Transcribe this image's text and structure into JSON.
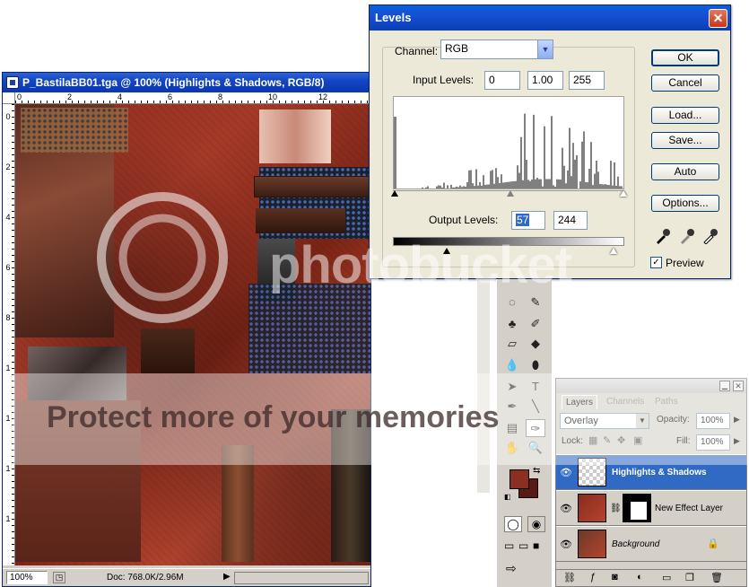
{
  "document": {
    "title": "P_BastilaBB01.tga @ 100% (Highlights & Shadows, RGB/8)",
    "ruler_top": [
      "0",
      "2",
      "4",
      "6",
      "8",
      "10",
      "12"
    ],
    "ruler_left": [
      "0",
      "2",
      "4",
      "6",
      "8",
      "1",
      "1",
      "1",
      "1"
    ],
    "zoom": "100%",
    "doc_size": "Doc: 768.0K/2.96M"
  },
  "levels": {
    "title": "Levels",
    "close": "✕",
    "channel_label": "Channel:",
    "channel_value": "RGB",
    "input_label": "Input Levels:",
    "input_black": "0",
    "input_gamma": "1.00",
    "input_white": "255",
    "output_label": "Output Levels:",
    "output_black": "57",
    "output_white": "244",
    "ok": "OK",
    "cancel": "Cancel",
    "load": "Load...",
    "save": "Save...",
    "auto": "Auto",
    "options": "Options...",
    "preview": "Preview",
    "preview_checked": "✓"
  },
  "layers": {
    "tabs": [
      "Layers",
      "Channels",
      "Paths"
    ],
    "blend_mode": "Overlay",
    "opacity_label": "Opacity:",
    "opacity": "100%",
    "lock_label": "Lock:",
    "fill_label": "Fill:",
    "fill": "100%",
    "items": [
      {
        "name": "Highlights & Shadows"
      },
      {
        "name": "New Effect Layer"
      },
      {
        "name": "Background"
      }
    ]
  },
  "watermark": {
    "logo": "photobucket",
    "banner": "Protect more of your memories"
  },
  "colors": {
    "titlebar": "#0a5fda",
    "selected_layer": "#316ac5",
    "foreground_swatch": "#8a2f22",
    "background_swatch": "#5a1a14"
  }
}
